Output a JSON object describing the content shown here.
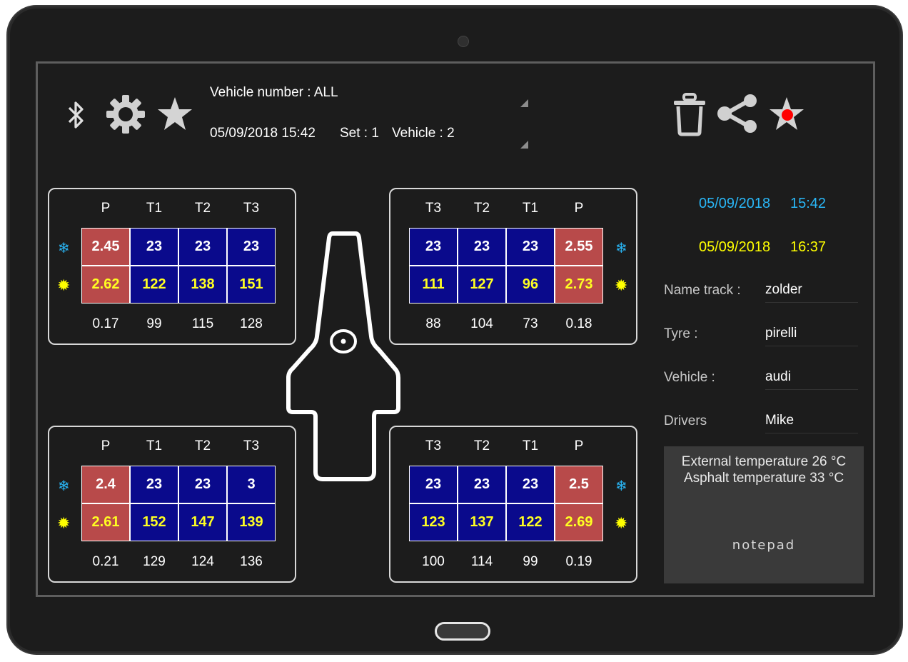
{
  "header": {
    "vehicle_number_label": "Vehicle number :  ALL",
    "datetime": "05/09/2018 15:42",
    "set": "Set : 1",
    "vehicle": "Vehicle : 2",
    "icons": [
      "bluetooth-icon",
      "gear-icon",
      "star-icon",
      "trash-icon",
      "share-icon",
      "star-record-icon"
    ]
  },
  "colors": {
    "cold_cell": "#0a0a8c",
    "pressure_cell": "#b84a4a",
    "hot_text": "#ffff22",
    "cold_indicator": "#29b6f6",
    "hot_indicator": "#ffff00",
    "date_start": "#29b6f6",
    "date_end": "#ffff00"
  },
  "tyres": {
    "front_left": {
      "headers": [
        "P",
        "T1",
        "T2",
        "T3"
      ],
      "cold": [
        "2.45",
        "23",
        "23",
        "23"
      ],
      "hot": [
        "2.62",
        "122",
        "138",
        "151"
      ],
      "delta": [
        "0.17",
        "99",
        "115",
        "128"
      ]
    },
    "front_right": {
      "headers": [
        "T3",
        "T2",
        "T1",
        "P"
      ],
      "cold": [
        "23",
        "23",
        "23",
        "2.55"
      ],
      "hot": [
        "111",
        "127",
        "96",
        "2.73"
      ],
      "delta": [
        "88",
        "104",
        "73",
        "0.18"
      ]
    },
    "rear_left": {
      "headers": [
        "P",
        "T1",
        "T2",
        "T3"
      ],
      "cold": [
        "2.4",
        "23",
        "23",
        "3"
      ],
      "hot": [
        "2.61",
        "152",
        "147",
        "139"
      ],
      "delta": [
        "0.21",
        "129",
        "124",
        "136"
      ]
    },
    "rear_right": {
      "headers": [
        "T3",
        "T2",
        "T1",
        "P"
      ],
      "cold": [
        "23",
        "23",
        "23",
        "2.5"
      ],
      "hot": [
        "123",
        "137",
        "122",
        "2.69"
      ],
      "delta": [
        "100",
        "114",
        "99",
        "0.19"
      ]
    }
  },
  "info": {
    "start_date": "05/09/2018",
    "start_time": "15:42",
    "end_date": "05/09/2018",
    "end_time": "16:37",
    "name_track_label": "Name track :",
    "name_track": "zolder",
    "tyre_label": "Tyre :",
    "tyre": "pirelli",
    "vehicle_label": "Vehicle :",
    "vehicle": "audi",
    "drivers_label": "Drivers",
    "drivers": "Mike"
  },
  "notepad": {
    "line1": "External temperature 26 °C",
    "line2": "Asphalt temperature 33 °C",
    "label": "notepad"
  }
}
